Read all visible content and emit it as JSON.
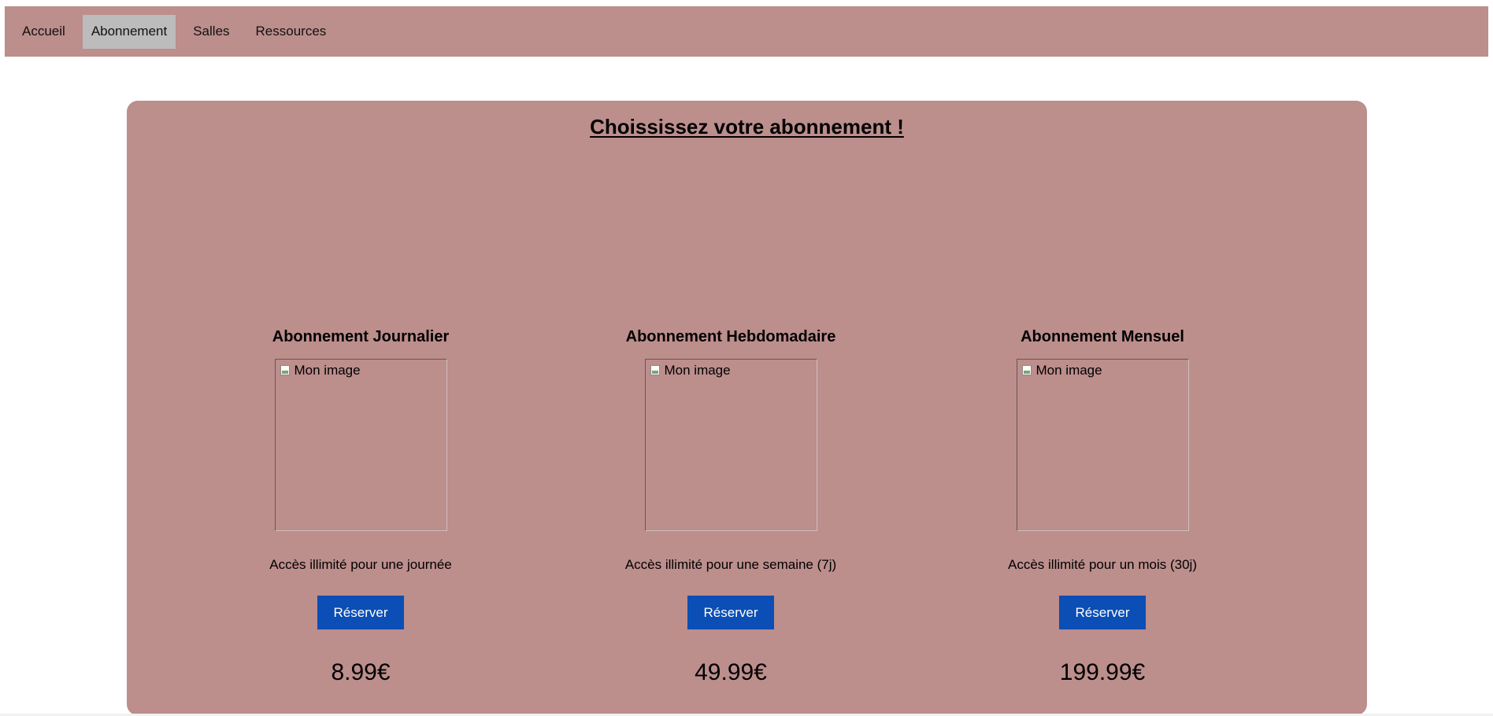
{
  "nav": {
    "items": [
      {
        "label": "Accueil",
        "active": false
      },
      {
        "label": "Abonnement",
        "active": true
      },
      {
        "label": "Salles",
        "active": false
      },
      {
        "label": "Ressources",
        "active": false
      }
    ]
  },
  "main": {
    "title": "Choississez votre abonnement !",
    "plans": [
      {
        "title": "Abonnement Journalier",
        "image_alt": "Mon image",
        "description": "Accès illimité pour une journée",
        "button_label": "Réserver",
        "price": "8.99€"
      },
      {
        "title": "Abonnement Hebdomadaire",
        "image_alt": "Mon image",
        "description": "Accès illimité pour une semaine (7j)",
        "button_label": "Réserver",
        "price": "49.99€"
      },
      {
        "title": "Abonnement Mensuel",
        "image_alt": "Mon image",
        "description": "Accès illimité pour un mois (30j)",
        "button_label": "Réserver",
        "price": "199.99€"
      }
    ]
  },
  "colors": {
    "background": "#bc8e8c",
    "active_nav": "#bcbcbc",
    "button": "#0b4eb5"
  },
  "icons": {
    "broken_image": "broken-image-icon"
  }
}
